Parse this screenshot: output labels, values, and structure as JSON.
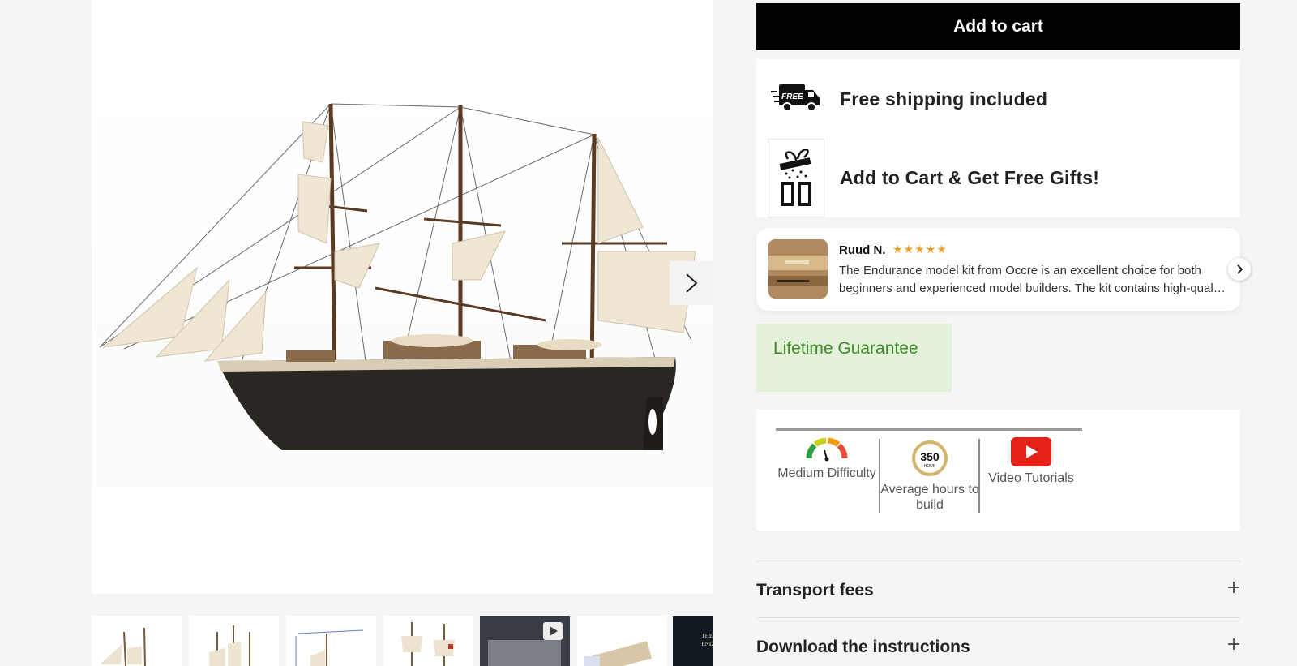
{
  "product": {
    "add_to_cart_label": "Add to cart",
    "perks": [
      {
        "label": "Free shipping included",
        "icon": "free-shipping-truck-icon",
        "badge": "FREE"
      },
      {
        "label": "Add to Cart & Get Free Gifts!",
        "icon": "gift-box-icon"
      }
    ]
  },
  "review": {
    "name": "Ruud N.",
    "rating": 5,
    "stars": "★★★★★",
    "text": "The Endurance model kit from Occre is an excellent choice for both beginners and experienced model builders. The kit contains high-quality materials and detailed instructions"
  },
  "guarantee": {
    "label": "Lifetime Guarantee"
  },
  "specs": [
    {
      "icon": "difficulty-gauge-icon",
      "label": "Medium Difficulty"
    },
    {
      "icon": "clock-badge-icon",
      "badge": "350",
      "badge_sub": "HOUR",
      "label": "Average hours to build"
    },
    {
      "icon": "youtube-icon",
      "label": "Video Tutorials"
    }
  ],
  "accordions": [
    {
      "title": "Transport fees"
    },
    {
      "title": "Download the instructions"
    }
  ],
  "thumbnails": [
    {
      "icon": "ship-thumbnail"
    },
    {
      "icon": "ship-thumbnail"
    },
    {
      "icon": "ship-dimensions-thumbnail"
    },
    {
      "icon": "ship-front-thumbnail"
    },
    {
      "icon": "video-thumbnail"
    },
    {
      "icon": "kit-parts-thumbnail"
    },
    {
      "icon": "box-cover-thumbnail",
      "text": "THE ENDURANCE"
    }
  ],
  "colors": {
    "accent_button": "#000000",
    "guarantee_bg": "#e3f2d8",
    "guarantee_text": "#3f8a2b",
    "star": "#f0a02b",
    "youtube": "#e62117",
    "hull": "#2a2622",
    "sail": "#efe6d4"
  }
}
